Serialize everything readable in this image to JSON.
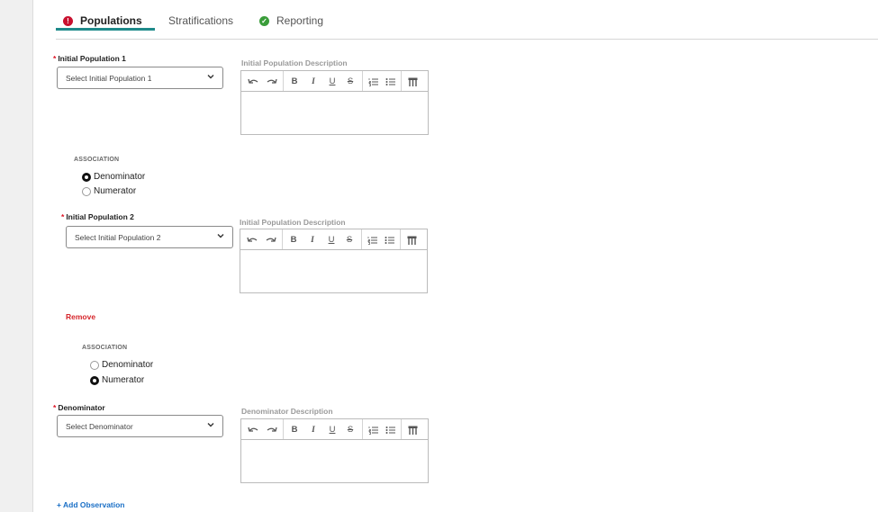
{
  "tabs": [
    {
      "label": "Populations",
      "status": "error",
      "status_icon": "!"
    },
    {
      "label": "Stratifications"
    },
    {
      "label": "Reporting",
      "status": "ok",
      "status_icon": "✓"
    }
  ],
  "required_mark": "*",
  "populations": [
    {
      "label": "Initial Population 1",
      "select_placeholder": "Select Initial Population 1",
      "description_label": "Initial Population Description",
      "association_title": "ASSOCIATION",
      "association_options": [
        "Denominator",
        "Numerator"
      ],
      "association_selected": "Denominator"
    },
    {
      "label": "Initial Population 2",
      "select_placeholder": "Select Initial Population 2",
      "description_label": "Initial Population Description",
      "remove_label": "Remove",
      "association_title": "ASSOCIATION",
      "association_options": [
        "Denominator",
        "Numerator"
      ],
      "association_selected": "Numerator"
    }
  ],
  "denominator": {
    "label": "Denominator",
    "select_placeholder": "Select Denominator",
    "description_label": "Denominator Description"
  },
  "add_observation_label": "+ Add Observation",
  "toolbar": {
    "undo": "undo-icon",
    "redo": "redo-icon",
    "bold": "B",
    "italic": "I",
    "underline": "U",
    "strike": "S",
    "ordered_list": "ordered-list-icon",
    "bullet_list": "bullet-list-icon",
    "table": "table-icon"
  },
  "colors": {
    "accent": "#1e8a8a",
    "error": "#c8102e",
    "ok": "#3a9d3a",
    "remove": "#d6262b",
    "link": "#1a6fc6"
  }
}
